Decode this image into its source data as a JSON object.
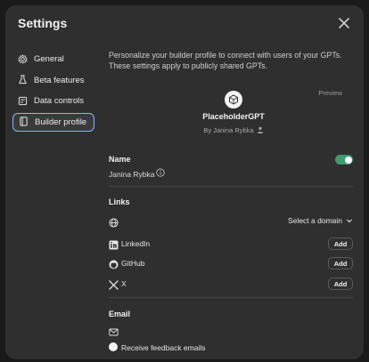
{
  "dialog": {
    "title": "Settings"
  },
  "sidebar": {
    "items": [
      {
        "label": "General",
        "icon": "gear-icon",
        "active": false
      },
      {
        "label": "Beta features",
        "icon": "flask-icon",
        "active": false
      },
      {
        "label": "Data controls",
        "icon": "database-icon",
        "active": false
      },
      {
        "label": "Builder profile",
        "icon": "id-card-icon",
        "active": true
      }
    ]
  },
  "builder": {
    "intro": "Personalize your builder profile to connect with users of your GPTs. These settings apply to publicly shared GPTs.",
    "preview_label": "Preview",
    "gpt_name": "PlaceholderGPT",
    "by_line": "By Janina Rybka",
    "name_section": {
      "label": "Name",
      "value": "Janina Rybka",
      "toggle_on": true
    },
    "links_section": {
      "label": "Links",
      "domain_select": "Select a domain",
      "rows": [
        {
          "label": "LinkedIn",
          "icon": "linkedin-icon",
          "button": "Add"
        },
        {
          "label": "GitHub",
          "icon": "github-icon",
          "button": "Add"
        },
        {
          "label": "X",
          "icon": "x-logo-icon",
          "button": "Add"
        }
      ]
    },
    "email_section": {
      "label": "Email",
      "feedback_label": "Receive feedback emails"
    }
  },
  "colors": {
    "accent_toggle": "#3f9a6e",
    "active_border": "#8ab4ff",
    "background": "#2f2f2f"
  }
}
